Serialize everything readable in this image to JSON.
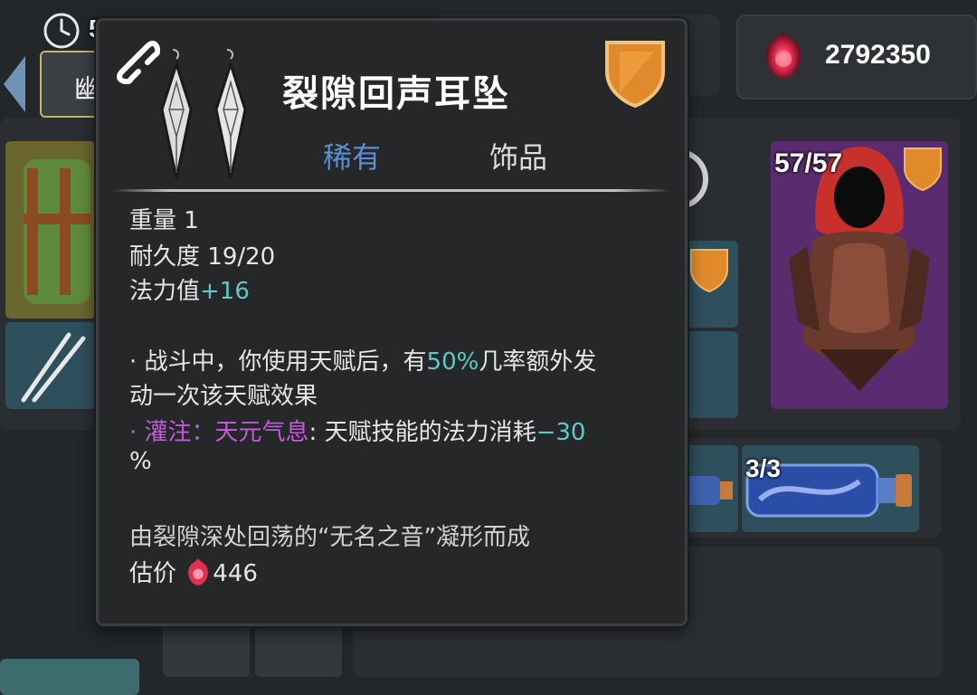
{
  "hud": {
    "timer_text": "5",
    "left_tab_text": "幽"
  },
  "currency": {
    "icon": "red-soul-gem-icon",
    "value": "2792350"
  },
  "character": {
    "hp_text": "57/57"
  },
  "inventory": {
    "potion_count": "3/3"
  },
  "tooltip": {
    "title": "裂隙回声耳坠",
    "rarity": "稀有",
    "category": "饰品",
    "stats": {
      "weight_label": "重量",
      "weight_value": "1",
      "durability_label": "耐久度",
      "durability_value": "19/20",
      "mana_label": "法力值",
      "mana_value": "+16"
    },
    "effects": {
      "effect1_bullet": "·",
      "effect1_pre": "战斗中，你使用天赋后，有",
      "effect1_pct": "50%",
      "effect1_post": "几率额外发",
      "effect1_line2": "动一次该天赋效果",
      "effect2_bullet": "·",
      "effect2_tag": "灌注：天元气息",
      "effect2_text": ": 天赋技能的法力消耗",
      "effect2_value": "−30",
      "effect2_line2": "%"
    },
    "flavor": "由裂隙深处回荡的“无名之音”凝形而成",
    "price_label": "估价",
    "price_value": "446"
  },
  "colors": {
    "rarity_rare": "#5a8fd6",
    "stat_positive": "#5fc8c9",
    "infusion": "#c15bd8",
    "shield_orange": "#e08a2c"
  }
}
